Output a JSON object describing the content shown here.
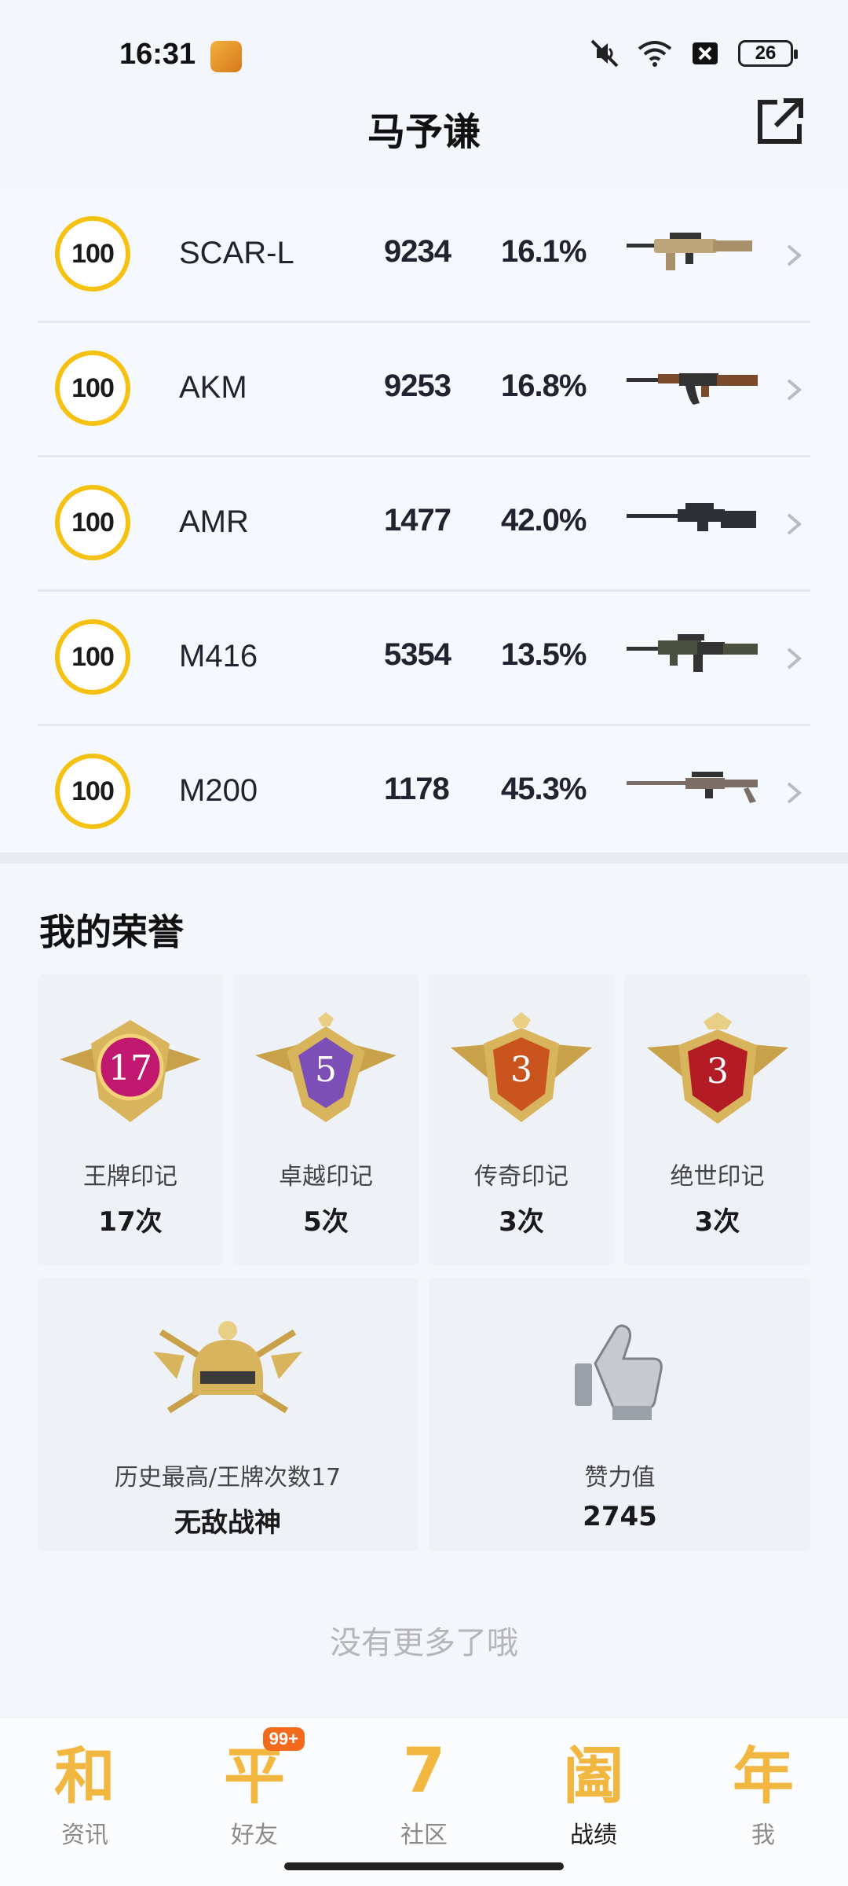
{
  "status_bar": {
    "time": "16:31",
    "battery": "26",
    "icons": [
      "notification-app-icon",
      "mute-icon",
      "wifi-icon",
      "sim-off-icon",
      "battery-icon"
    ]
  },
  "header": {
    "title": "马予谦",
    "share_icon": "share-external-icon"
  },
  "weapons": [
    {
      "level": "100",
      "name": "SCAR-L",
      "kills": "9234",
      "rate": "16.1%",
      "color": "#bfa67a"
    },
    {
      "level": "100",
      "name": "AKM",
      "kills": "9253",
      "rate": "16.8%",
      "color": "#7a4a2a"
    },
    {
      "level": "100",
      "name": "AMR",
      "kills": "1477",
      "rate": "42.0%",
      "color": "#2c2f33"
    },
    {
      "level": "100",
      "name": "M416",
      "kills": "5354",
      "rate": "13.5%",
      "color": "#4a5040"
    },
    {
      "level": "100",
      "name": "M200",
      "kills": "1178",
      "rate": "45.3%",
      "color": "#7a6e66"
    }
  ],
  "honor": {
    "title": "我的荣誉",
    "marks": [
      {
        "number": "17",
        "label": "王牌印记",
        "value": "17次",
        "color": "#c0186e"
      },
      {
        "number": "5",
        "label": "卓越印记",
        "value": "5次",
        "color": "#7b4fb5"
      },
      {
        "number": "3",
        "label": "传奇印记",
        "value": "3次",
        "color": "#c9541e"
      },
      {
        "number": "3",
        "label": "绝世印记",
        "value": "3次",
        "color": "#b31c25"
      }
    ],
    "history": {
      "label": "历史最高/王牌次数17",
      "value": "无敌战神"
    },
    "likes": {
      "label": "赞力值",
      "value": "2745"
    }
  },
  "footer_note": "没有更多了哦",
  "nav": {
    "items": [
      {
        "label": "资讯",
        "glyph": "和",
        "active": false
      },
      {
        "label": "好友",
        "glyph": "平",
        "badge": "99+",
        "active": false
      },
      {
        "label": "社区",
        "glyph": "7",
        "active": false
      },
      {
        "label": "战绩",
        "glyph": "阖",
        "active": true
      },
      {
        "label": "我",
        "glyph": "年",
        "active": false
      }
    ]
  }
}
